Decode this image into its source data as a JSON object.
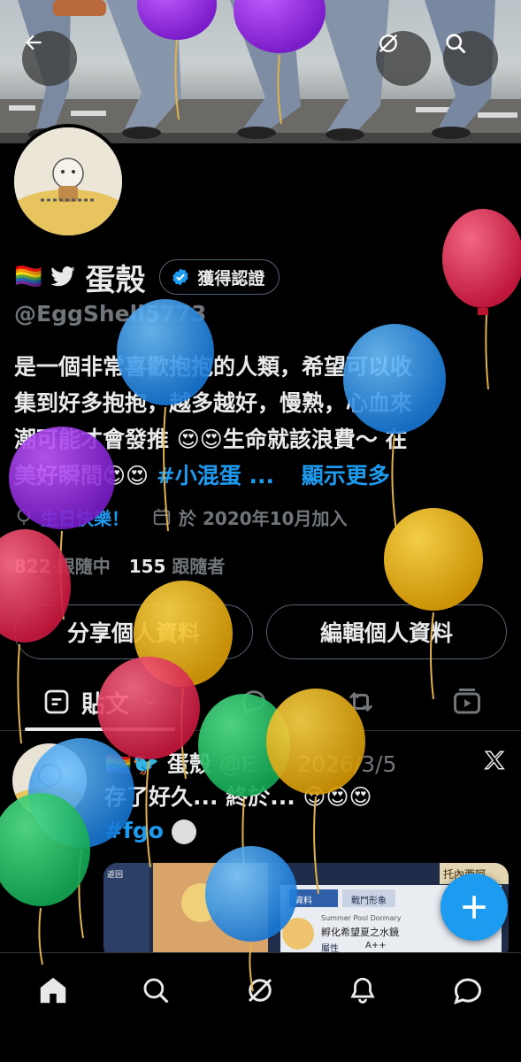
{
  "header": {
    "back_icon": "arrow-left-icon",
    "grok_icon": "grok-icon",
    "search_icon": "search-icon"
  },
  "profile": {
    "flag_emoji": "🏳️‍🌈",
    "bird_emoji": "🐦",
    "name": "蛋殼",
    "verify_label": "獲得認證",
    "handle": "@EggShell5773",
    "bio_lines": [
      "是一個非常喜歡抱抱的人類，希望可以收",
      "集到好多抱抱，越多越好，慢熟，心血來",
      "潮可能才會發推 😍😍生命就該浪費～ 在"
    ],
    "bio_last_prefix": "美好瞬間😍😍 ",
    "bio_hashtag": "#小混蛋 ...",
    "show_more": "顯示更多",
    "birthday": "生日快樂！",
    "joined": "於 2020年10月加入",
    "following_count": "822",
    "following_label": "跟隨中",
    "followers_count": "155",
    "followers_label": "跟隨者",
    "share_button": "分享個人資料",
    "edit_button": "編輯個人資料"
  },
  "tabs": {
    "posts_label": "貼文"
  },
  "post": {
    "name": "🏳️‍🌈🐦 蛋殼",
    "meta": "@E... · 2026/3/5",
    "text_line1": "存了好久... 終於... 😍😍😍",
    "hashtag": "#fgo",
    "media_texts": {
      "title": "托內西呵",
      "tab1": "資料",
      "tab2": "戰鬥形象",
      "item_en": "Summer Pool Dormary",
      "item_title": "孵化希望夏之水鏡",
      "rank_label": "屬性",
      "rank_value": "A++",
      "back_label": "返回"
    }
  },
  "colors": {
    "accent": "#1d9bf0",
    "text": "#e7e9ea",
    "muted": "#71767b",
    "border": "#536471"
  }
}
